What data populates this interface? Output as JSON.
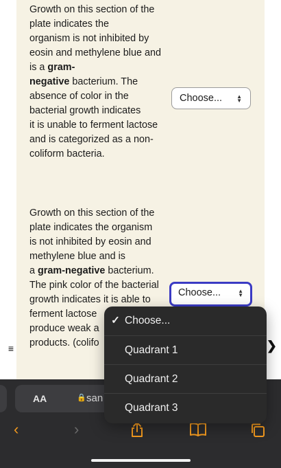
{
  "question1": {
    "l1": "Growth on this section of the",
    "l2": "plate indicates the",
    "l3": "organism is not inhibited by",
    "l4": "eosin and methylene blue and",
    "l5_pre": "is a ",
    "l5_bold": "gram-",
    "l6_bold": "negative",
    "l6_post": " bacterium.  The",
    "l7": "absence of color in the",
    "l8": "bacterial growth indicates",
    "l9": "it is unable to ferment lactose",
    "l10": "and is categorized as a non-",
    "l11": "coliform bacteria.",
    "select_value": "Choose..."
  },
  "question2": {
    "l1": "Growth on this section of the",
    "l2": "plate indicates the organism",
    "l3": "is not inhibited by eosin and",
    "l4": "methylene blue and is",
    "l5_pre": "a ",
    "l5_bold": "gram-negative",
    "l5_post": " bacterium.",
    "l6": "The pink color of the bacterial",
    "l7": "growth indicates it is able to",
    "l8": "ferment lactose",
    "l9": "produce weak a",
    "l10": "products. (colifo",
    "select_value": "Choose..."
  },
  "dropdown": {
    "selected_check": "✓",
    "options": [
      "Choose...",
      "Quadrant 1",
      "Quadrant 2",
      "Quadrant 3"
    ]
  },
  "browser": {
    "aa_label": "AA",
    "url_partial": "san",
    "nav_icons": [
      "back-icon",
      "forward-icon",
      "share-icon",
      "bookmarks-icon",
      "tabs-icon"
    ]
  },
  "side": {
    "list_icon": "≡",
    "next_icon": "❯"
  },
  "colors": {
    "page_beige": "#f6f2e4",
    "focus_ring": "#3b3bc4",
    "toolbar_bg": "#2c2c2e",
    "accent_orange": "#f39a1f"
  }
}
